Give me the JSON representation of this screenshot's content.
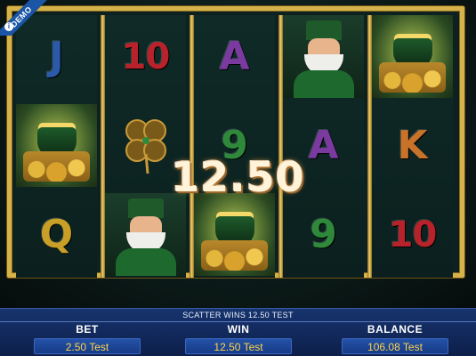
{
  "demo_badge": {
    "label": "DEMO",
    "icon": "info-icon"
  },
  "reels": [
    {
      "symbols": [
        {
          "type": "letter",
          "text": "J",
          "color": "#2a5aa8"
        },
        {
          "type": "pot"
        },
        {
          "type": "letter",
          "text": "Q",
          "color": "#c8a028"
        }
      ]
    },
    {
      "symbols": [
        {
          "type": "letter",
          "text": "10",
          "color": "#b8222a"
        },
        {
          "type": "clover"
        },
        {
          "type": "leprechaun"
        }
      ]
    },
    {
      "symbols": [
        {
          "type": "letter",
          "text": "A",
          "color": "#7a3aa0"
        },
        {
          "type": "letter",
          "text": "9",
          "color": "#2e8a3a"
        },
        {
          "type": "pot"
        }
      ]
    },
    {
      "symbols": [
        {
          "type": "leprechaun"
        },
        {
          "type": "letter",
          "text": "A",
          "color": "#7a3aa0"
        },
        {
          "type": "letter",
          "text": "9",
          "color": "#2e8a3a"
        }
      ]
    },
    {
      "symbols": [
        {
          "type": "pot"
        },
        {
          "type": "letter",
          "text": "K",
          "color": "#c8722a"
        },
        {
          "type": "letter",
          "text": "10",
          "color": "#b8222a"
        }
      ]
    }
  ],
  "win_display": "12.50",
  "status_message": "SCATTER WINS 12.50 TEST",
  "stats": {
    "bet": {
      "label": "BET",
      "value": "2.50 Test"
    },
    "win": {
      "label": "WIN",
      "value": "12.50 Test"
    },
    "balance": {
      "label": "BALANCE",
      "value": "106.08 Test"
    }
  },
  "colors": {
    "frame_gold": "#d6b24a",
    "bar_blue": "#17346e",
    "value_yellow": "#ffd34a"
  }
}
